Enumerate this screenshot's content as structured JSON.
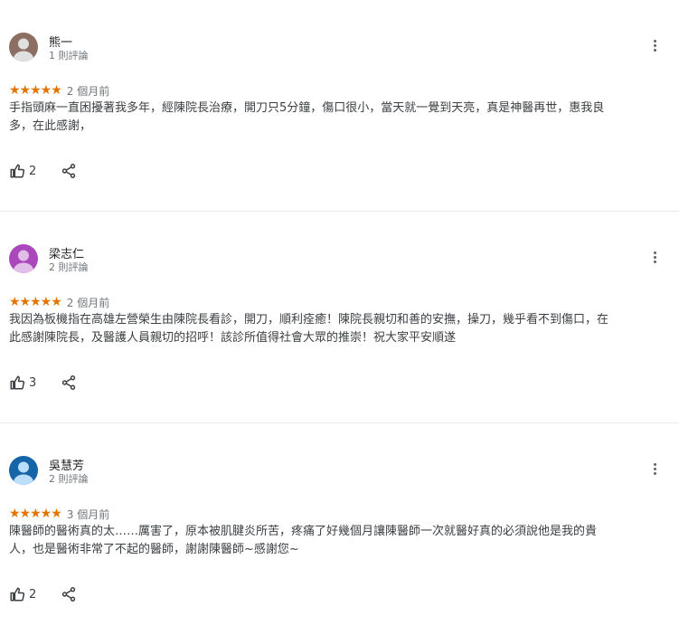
{
  "reviews": [
    {
      "name": "熊一",
      "review_count": "1 則評論",
      "stars": "★★★★★",
      "date": "2 個月前",
      "text": "手指頭麻一直困擾著我多年，經陳院長治療，開刀只5分鐘，傷口很小，當天就一覺到天亮，真是神醫再世，惠我良多，在此感謝，",
      "likes": "2",
      "avatar_color": "#8d6e63"
    },
    {
      "name": "梁志仁",
      "review_count": "2 則評論",
      "stars": "★★★★★",
      "date": "2 個月前",
      "text": "我因為板機指在高雄左營榮生由陳院長看診，開刀，順利痊癒！陳院長親切和善的安撫，操刀，幾乎看不到傷口，在此感謝陳院長，及醫護人員親切的招呼！該診所值得社會大眾的推崇！祝大家平安順遂",
      "likes": "3",
      "avatar_color": "#ab47bc"
    },
    {
      "name": "吳慧芳",
      "review_count": "2 則評論",
      "stars": "★★★★★",
      "date": "3 個月前",
      "text": "陳醫師的醫術真的太……厲害了，原本被肌腱炎所苦，疼痛了好幾個月讓陳醫師一次就醫好真的必須說他是我的貴人，也是醫術非常了不起的醫師，謝謝陳醫師~感謝您~",
      "likes": "2",
      "avatar_color": "#1565a8"
    }
  ],
  "icons": {
    "menu": "more-vert-icon",
    "like": "thumb-up-icon",
    "share": "share-icon",
    "avatar": "person-icon"
  },
  "colors": {
    "star": "#e37400",
    "secondary_text": "#70757a",
    "body_text": "#3c4043"
  }
}
